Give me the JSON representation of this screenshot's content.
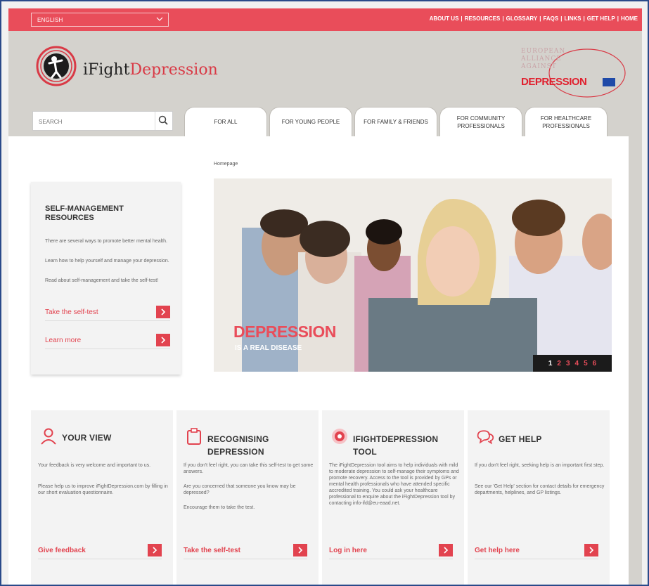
{
  "topbar": {
    "language": "ENGLISH",
    "nav": [
      "ABOUT US",
      "RESOURCES",
      "GLOSSARY",
      "FAQS",
      "LINKS",
      "GET HELP",
      "HOME"
    ]
  },
  "header": {
    "logo_prefix": "iFight",
    "logo_suffix": "Depression",
    "eaad_line1": "EUROPEAN",
    "eaad_line2": "ALLIANCE",
    "eaad_line3": "AGAINST",
    "eaad_big": "DEPRESSION",
    "search_placeholder": "SEARCH",
    "tabs": [
      "FOR ALL",
      "FOR YOUNG PEOPLE",
      "FOR FAMILY & FRIENDS",
      "FOR COMMUNITY PROFESSIONALS",
      "FOR HEALTHCARE PROFESSIONALS"
    ]
  },
  "breadcrumb": "Homepage",
  "selfmanagement": {
    "title": "SELF-MANAGEMENT RESOURCES",
    "para1": "There are several ways to promote better mental health.",
    "para2": "Learn how to help yourself and manage your depression.",
    "para3": "Read about self-management and take the self-test!",
    "link1": "Take the self-test",
    "link2": "Learn more"
  },
  "hero": {
    "title_dep": "DEPRESSION",
    "subtitle": "IS A REAL DISEASE",
    "pages": [
      "1",
      "2",
      "3",
      "4",
      "5",
      "6"
    ]
  },
  "cards": [
    {
      "title": "YOUR VIEW",
      "p1": "Your feedback is very welcome and important to us.",
      "p2": "Please help us to improve iFightDepression.com by filling in our short evaluation questionnaire.",
      "p3": "",
      "link": "Give feedback"
    },
    {
      "title": "RECOGNISING DEPRESSION",
      "p1": "If you don't feel right, you can take this self-test to get some answers.",
      "p2": "Are you concerned that someone you know may be depressed?",
      "p3": "Encourage them to take the test.",
      "link": "Take the self-test"
    },
    {
      "title": "IFIGHTDEPRESSION TOOL",
      "p1": "The iFightDepression tool aims to help individuals with mild to moderate depression to self-manage their symptoms and promote recovery. Access to the tool is provided by GPs or mental health professionals who have attended specific accredited training. You could ask your healthcare professional to enquire about the iFightDepression tool by contacting info-ifd@eu-eaad.net.",
      "p2": "",
      "p3": "",
      "link": "Log in here"
    },
    {
      "title": "GET HELP",
      "p1": "If you don't feel right, seeking help is an important first step.",
      "p2": "See our 'Get Help' section for contact details for emergency departments, helplines, and GP listings.",
      "p3": "",
      "link": "Get help here"
    }
  ],
  "colors": {
    "accent": "#e94d5a",
    "header_bg": "#d4d2cd",
    "text": "#333333"
  }
}
